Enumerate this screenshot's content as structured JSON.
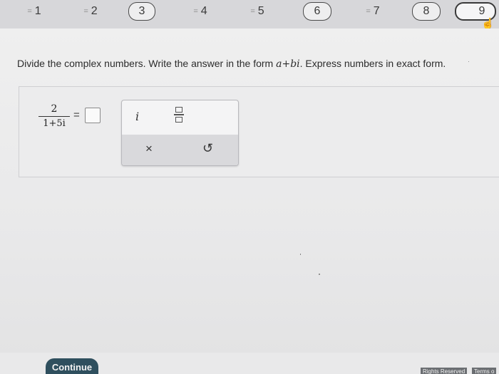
{
  "question_nav": {
    "items": [
      {
        "label": "1",
        "answered": true
      },
      {
        "label": "2",
        "answered": true
      },
      {
        "label": "3",
        "answered": false
      },
      {
        "label": "4",
        "answered": true
      },
      {
        "label": "5",
        "answered": true
      },
      {
        "label": "6",
        "answered": false
      },
      {
        "label": "7",
        "answered": true
      },
      {
        "label": "8",
        "answered": false
      },
      {
        "label": "9",
        "answered": false,
        "current": true
      }
    ],
    "answered_mark": "="
  },
  "instruction": {
    "text_prefix": "Divide the complex numbers. Write the answer in the form ",
    "math_form": "a+bi",
    "text_suffix": ". Express numbers in exact form."
  },
  "problem": {
    "numerator": "2",
    "denominator": "1+5i",
    "equals": "="
  },
  "palette": {
    "imaginary_symbol": "i",
    "clear_symbol": "×",
    "undo_symbol": "↺"
  },
  "continue_label": "Continue",
  "footer": {
    "rights": "Rights Reserved",
    "terms": "Terms o"
  }
}
